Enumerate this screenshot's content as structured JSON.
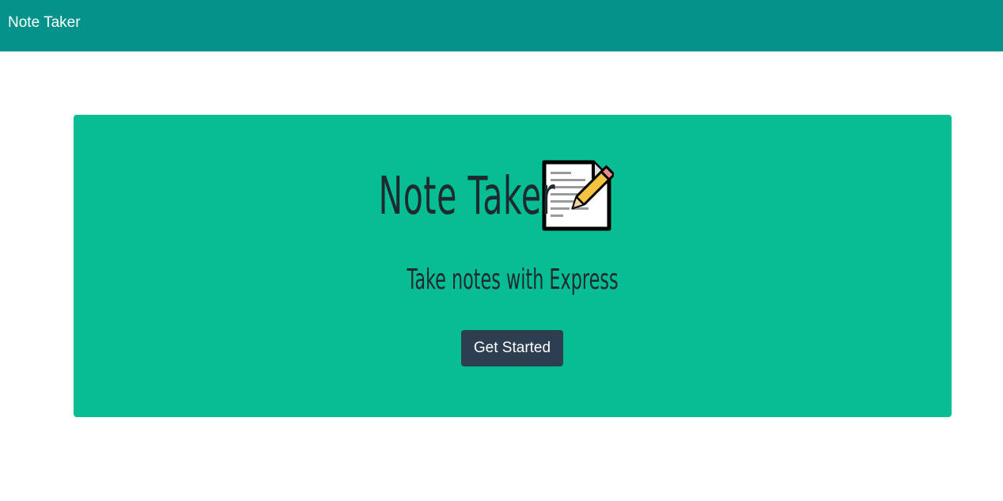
{
  "navbar": {
    "brand": "Note Taker"
  },
  "hero": {
    "title": "Note Taker",
    "title_icon": "memo-icon",
    "subtitle": "Take notes with Express",
    "cta_label": "Get Started"
  },
  "colors": {
    "navbar_bg": "#04928a",
    "hero_bg": "#07bd94",
    "button_bg": "#2d3e50",
    "text_dark": "#1e2a2e"
  }
}
